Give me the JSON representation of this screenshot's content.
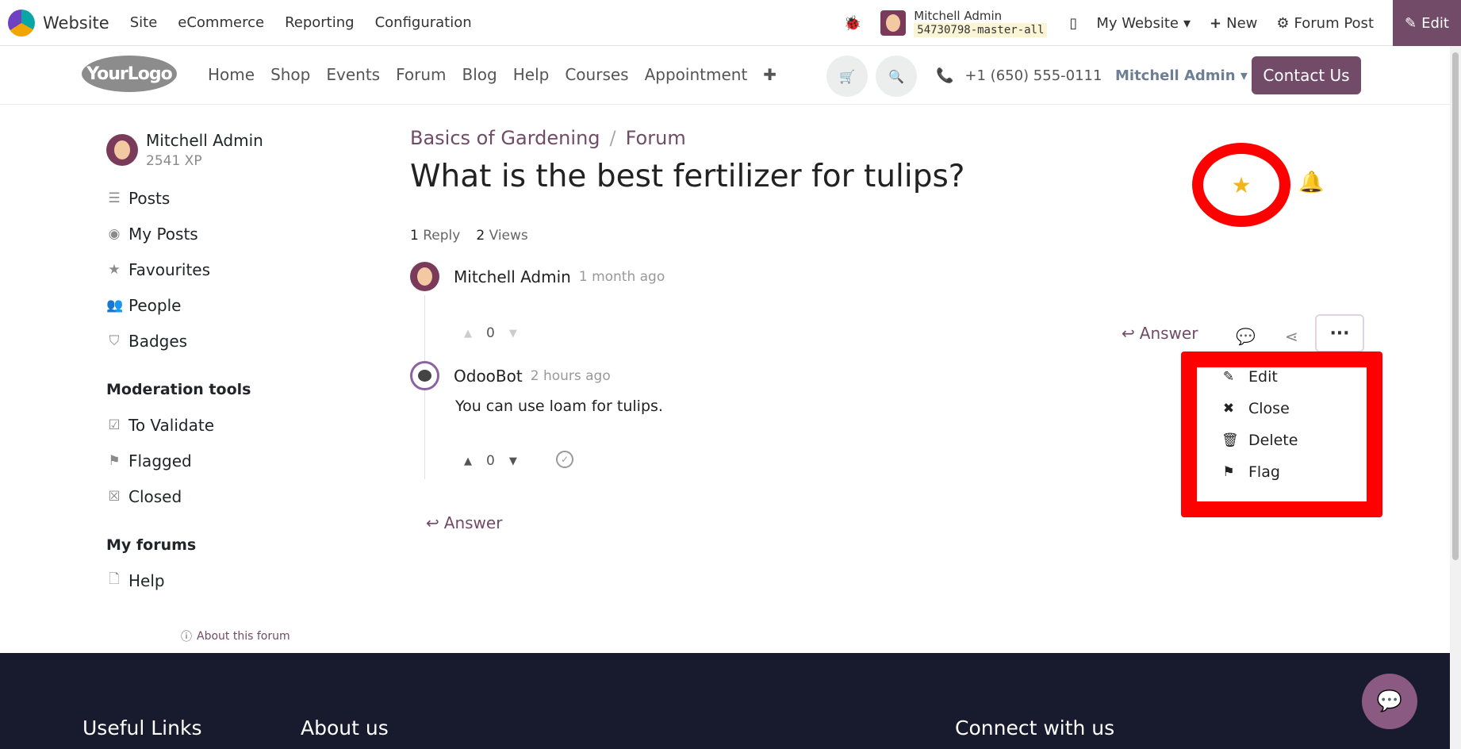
{
  "adminbar": {
    "brand": "Website",
    "menu": [
      "Site",
      "eCommerce",
      "Reporting",
      "Configuration"
    ],
    "user_name": "Mitchell Admin",
    "database": "54730798-master-all",
    "my_website": "My Website",
    "new_label": "New",
    "forum_post_label": "Forum Post",
    "edit_label": "Edit"
  },
  "siteheader": {
    "logo_text": "YourLogo",
    "nav": [
      "Home",
      "Shop",
      "Events",
      "Forum",
      "Blog",
      "Help",
      "Courses",
      "Appointment"
    ],
    "phone": "+1 (650) 555-0111",
    "user": "Mitchell Admin",
    "contact": "Contact Us"
  },
  "sidebar": {
    "user_name": "Mitchell Admin",
    "xp": "2541 XP",
    "items": [
      "Posts",
      "My Posts",
      "Favourites",
      "People",
      "Badges"
    ],
    "moderation_heading": "Moderation tools",
    "moderation_items": [
      "To Validate",
      "Flagged",
      "Closed"
    ],
    "forums_heading": "My forums",
    "forums_items": [
      "Help"
    ],
    "about": "About this forum"
  },
  "post": {
    "breadcrumb": [
      "Basics of Gardening",
      "Forum"
    ],
    "title": "What is the best fertilizer for tulips?",
    "reply_count": "1",
    "reply_label": "Reply",
    "view_count": "2",
    "view_label": "Views",
    "author": "Mitchell Admin",
    "ago": "1 month ago",
    "votes": "0",
    "answer_label": "Answer"
  },
  "reply": {
    "author": "OdooBot",
    "ago": "2 hours ago",
    "text": "You can use loam for tulips.",
    "votes": "0"
  },
  "bottom_answer": "Answer",
  "dropdown": {
    "items": [
      "Edit",
      "Close",
      "Delete",
      "Flag"
    ]
  },
  "footer": {
    "useful_links": "Useful Links",
    "about_us": "About us",
    "connect": "Connect with us"
  },
  "colors": {
    "brand": "#714b67",
    "highlight": "#ff0000",
    "star": "#f3b41a",
    "footer": "#181a2e"
  }
}
